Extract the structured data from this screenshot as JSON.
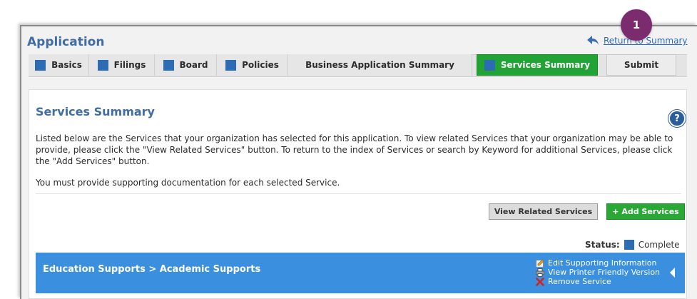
{
  "header": {
    "title": "Application",
    "return_link": "Return to Summary",
    "step_badge": "1"
  },
  "tabs": [
    {
      "label": "Basics",
      "icon": "square-icon"
    },
    {
      "label": "Filings",
      "icon": "square-icon"
    },
    {
      "label": "Board",
      "icon": "square-icon"
    },
    {
      "label": "Policies",
      "icon": "square-icon"
    },
    {
      "label": "Business Application Summary"
    },
    {
      "label": "Services Summary",
      "icon": "square-icon",
      "active": true
    },
    {
      "label": "Submit"
    }
  ],
  "section": {
    "title": "Services Summary",
    "help_label": "?",
    "paragraph1": "Listed below are the Services that your organization has selected for this application. To view related Services that your organization may be able to provide, please click the \"View Related Services\" button. To return to the index of Services or search by Keyword for additional Services, please click the \"Add Services\" button.",
    "paragraph2": "You must provide supporting documentation for each selected Service."
  },
  "buttons": {
    "view_related": "View Related Services",
    "add_services": "+ Add Services"
  },
  "status": {
    "label": "Status:",
    "value": "Complete"
  },
  "service_row": {
    "path": "Education Supports > Academic Supports",
    "actions": [
      {
        "label": "Edit Supporting Information",
        "icon": "edit-icon"
      },
      {
        "label": "View Printer Friendly Version",
        "icon": "printer-icon"
      },
      {
        "label": "Remove Service",
        "icon": "remove-icon"
      }
    ]
  },
  "colors": {
    "title_blue": "#3f6da4",
    "tab_square": "#2b6cb5",
    "active_green": "#22a336",
    "row_blue": "#3a8fdf",
    "badge_purple": "#7b2c6f"
  }
}
